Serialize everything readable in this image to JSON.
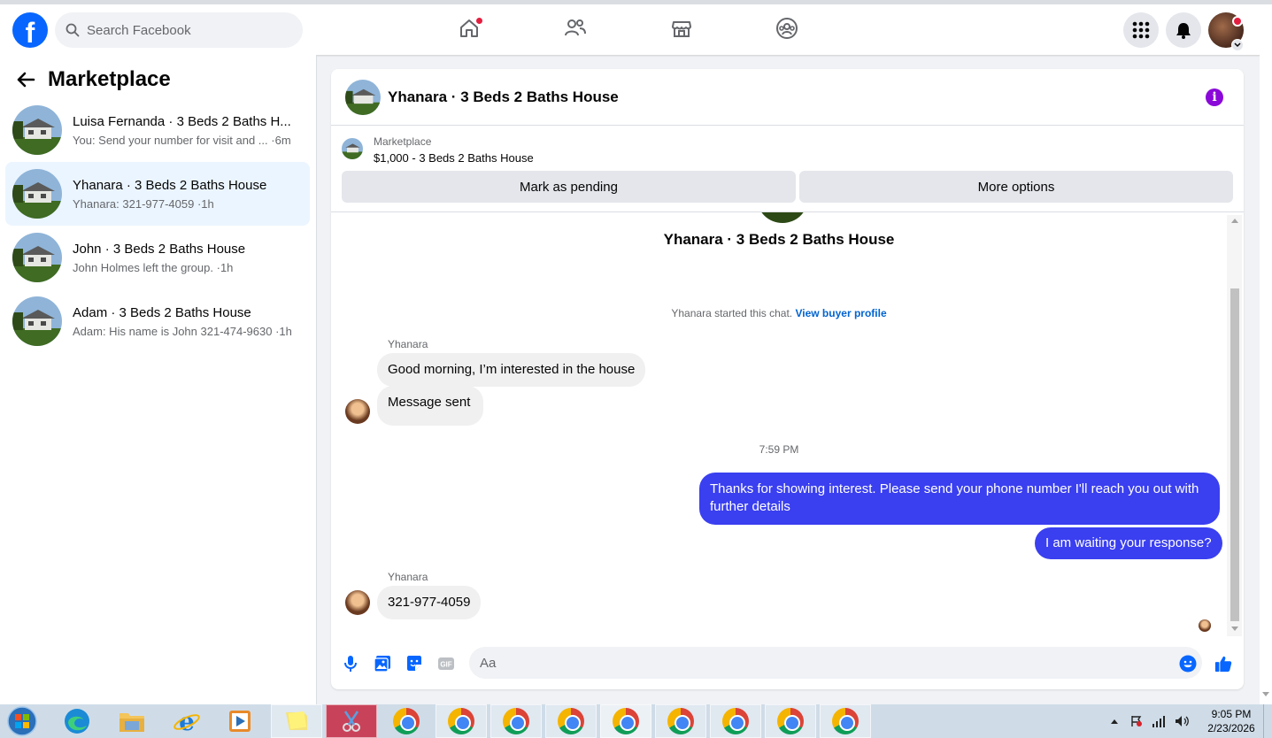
{
  "topbar": {
    "search_placeholder": "Search Facebook",
    "logo_letter": "f"
  },
  "sidebar": {
    "title": "Marketplace",
    "conversations": [
      {
        "name": "Luisa Fernanda · 3 Beds 2 Baths H...",
        "preview": "You: Send your number for visit and ...",
        "time": "·6m",
        "active": false
      },
      {
        "name": "Yhanara · 3 Beds 2 Baths House",
        "preview": "Yhanara: 321-977-4059",
        "time": "·1h",
        "active": true
      },
      {
        "name": "John · 3 Beds 2 Baths House",
        "preview": "John Holmes left the group.",
        "time": "·1h",
        "active": false
      },
      {
        "name": "Adam · 3 Beds 2 Baths House",
        "preview": "Adam: His name is John 321-474-9630",
        "time": "·1h",
        "active": false
      }
    ]
  },
  "chat": {
    "title": "Yhanara · 3 Beds 2 Baths House",
    "listing": {
      "label": "Marketplace",
      "price_title": "$1,000 - 3 Beds 2 Baths House",
      "pending_button": "Mark as pending",
      "options_button": "More options"
    },
    "conversation_title": "Yhanara · 3 Beds 2 Baths House",
    "started_text": "Yhanara started this chat.",
    "buyer_profile_link": "View buyer profile",
    "messages_1": {
      "sender": "Yhanara",
      "msg_a": "Good morning, I’m interested in the house",
      "msg_b": "Message sent"
    },
    "timestamp": "7:59 PM",
    "outgoing": {
      "msg_a": "Thanks for showing interest. Please send your phone number  I'll reach you out with further details",
      "msg_b": "I am waiting your response?"
    },
    "messages_2": {
      "sender": "Yhanara",
      "msg_a": "321-977-4059"
    },
    "composer_placeholder": "Aa"
  },
  "taskbar": {
    "time": "9:05 PM",
    "date": "2/23/2026"
  },
  "colors": {
    "brand": "#0866ff",
    "outgoing_bubble": "#3a3ff0",
    "active_conversation": "#ebf5ff",
    "notification_dot": "#e41e3f",
    "info_icon": "#8a09d8",
    "composer_icons": "#0866ff"
  }
}
